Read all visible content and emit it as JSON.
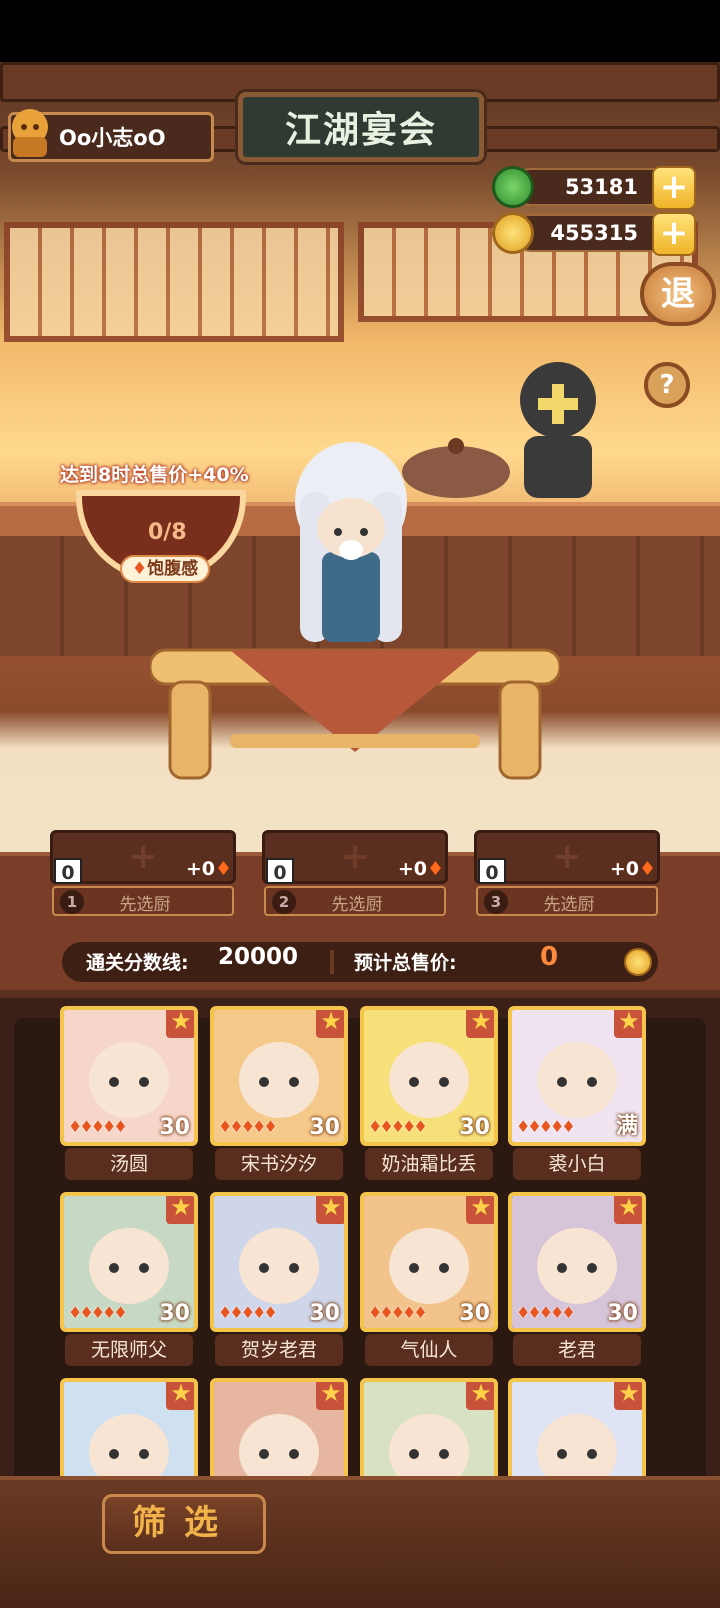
{
  "user": {
    "name": "Oo小志oO"
  },
  "sign": {
    "title": "江湖宴会"
  },
  "resources": {
    "jade": "53181",
    "coins": "455315"
  },
  "buttons": {
    "exit": "退",
    "help": "?",
    "filter": "筛选"
  },
  "bonus": {
    "text": "达到8时总售价+40%",
    "progress": "0/8",
    "satiety_label": "饱腹感"
  },
  "slots": [
    {
      "box": "0",
      "score": "+0",
      "num": "1",
      "label": "先选厨"
    },
    {
      "box": "0",
      "score": "+0",
      "num": "2",
      "label": "先选厨"
    },
    {
      "box": "0",
      "score": "+0",
      "num": "3",
      "label": "先选厨"
    }
  ],
  "score": {
    "threshold_label": "通关分数线:",
    "threshold_value": "20000",
    "price_label": "预计总售价:",
    "price_value": "0"
  },
  "cards": [
    {
      "name": "汤圆",
      "level": "30",
      "bg": "#f6d6c8"
    },
    {
      "name": "宋书汐汐",
      "level": "30",
      "bg": "#f5c98a"
    },
    {
      "name": "奶油霜比丢",
      "level": "30",
      "bg": "#f7e07a"
    },
    {
      "name": "裘小白",
      "level": "满",
      "bg": "#efe4f0"
    },
    {
      "name": "无限师父",
      "level": "30",
      "bg": "#c7d8c4"
    },
    {
      "name": "贺岁老君",
      "level": "30",
      "bg": "#cfd6ea"
    },
    {
      "name": "气仙人",
      "level": "30",
      "bg": "#f2c38a"
    },
    {
      "name": "老君",
      "level": "30",
      "bg": "#d6c4d8"
    },
    {
      "name": "",
      "level": "",
      "bg": "#cfe0f0"
    },
    {
      "name": "",
      "level": "",
      "bg": "#e6b6a0"
    },
    {
      "name": "",
      "level": "",
      "bg": "#d8e2c2"
    },
    {
      "name": "",
      "level": "",
      "bg": "#dfe4f4"
    }
  ]
}
